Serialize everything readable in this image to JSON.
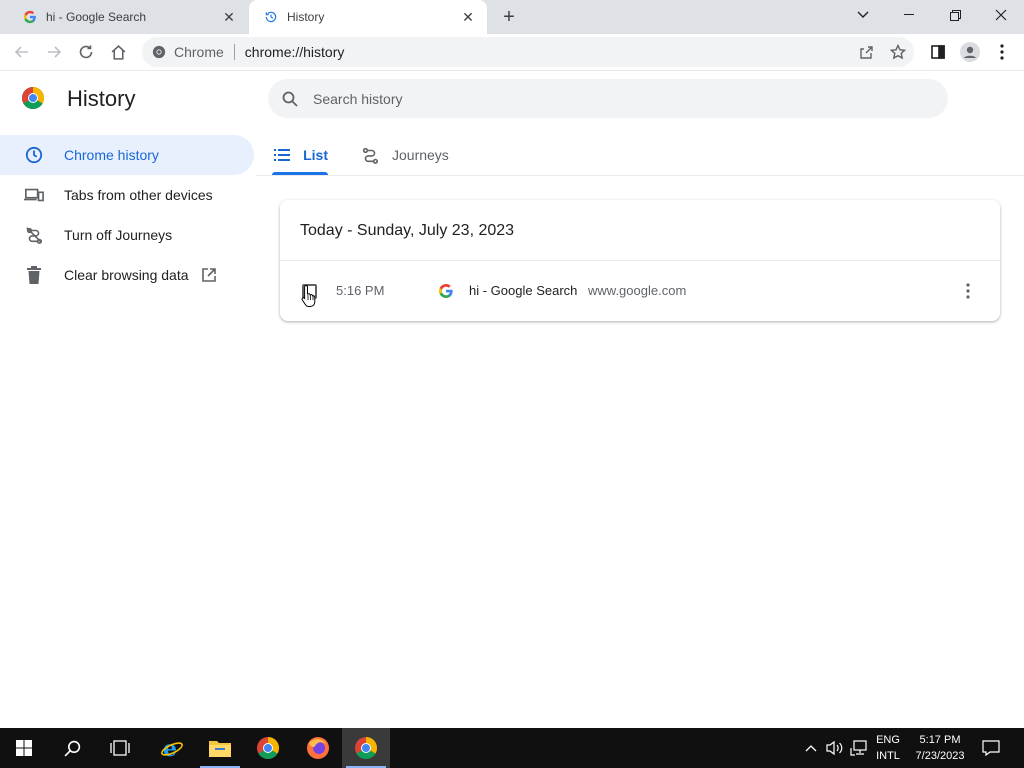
{
  "browser": {
    "tabs": [
      {
        "title": "hi - Google Search",
        "favicon": "google-g-icon",
        "active": false
      },
      {
        "title": "History",
        "favicon": "history-icon",
        "active": true
      }
    ],
    "omnibox": {
      "chip_label": "Chrome",
      "url": "chrome://history"
    }
  },
  "sidebar": {
    "title": "History",
    "items": [
      {
        "label": "Chrome history",
        "icon": "clock-icon",
        "selected": true
      },
      {
        "label": "Tabs from other devices",
        "icon": "devices-icon",
        "selected": false
      },
      {
        "label": "Turn off Journeys",
        "icon": "journeys-off-icon",
        "selected": false
      },
      {
        "label": "Clear browsing data",
        "icon": "trash-icon",
        "selected": false
      }
    ]
  },
  "search": {
    "placeholder": "Search history"
  },
  "history_tabs": [
    {
      "label": "List",
      "icon": "list-icon",
      "active": true
    },
    {
      "label": "Journeys",
      "icon": "journeys-icon",
      "active": false
    }
  ],
  "history": {
    "date_header": "Today - Sunday, July 23, 2023",
    "entries": [
      {
        "time": "5:16 PM",
        "title": "hi - Google Search",
        "domain": "www.google.com"
      }
    ]
  },
  "taskbar": {
    "language_top": "ENG",
    "language_bottom": "INTL",
    "time": "5:17 PM",
    "date": "7/23/2023"
  },
  "colors": {
    "accent": "#1a73e8",
    "selected_bg": "#e8f0fe",
    "selected_text": "#1967d2",
    "tabstrip": "#dee1e6",
    "taskbar": "#101010"
  }
}
